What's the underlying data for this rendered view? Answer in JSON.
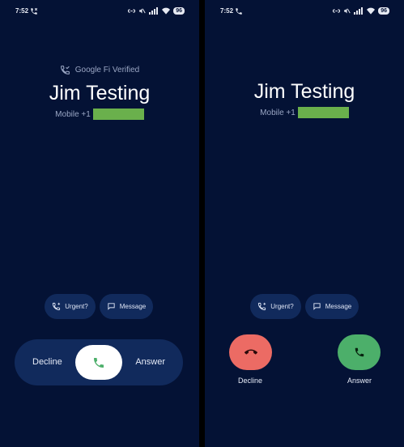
{
  "left_screen": {
    "status": {
      "time": "7:52",
      "battery": "96"
    },
    "verified_label": "Google Fi Verified",
    "caller_name": "Jim Testing",
    "caller_number_prefix": "Mobile +1",
    "chips": {
      "urgent": "Urgent?",
      "message": "Message"
    },
    "swipe": {
      "decline_label": "Decline",
      "answer_label": "Answer"
    }
  },
  "right_screen": {
    "status": {
      "time": "7:52",
      "battery": "96"
    },
    "caller_name": "Jim Testing",
    "caller_number_prefix": "Mobile +1",
    "chips": {
      "urgent": "Urgent?",
      "message": "Message"
    },
    "buttons": {
      "decline_label": "Decline",
      "answer_label": "Answer"
    }
  },
  "icons": {
    "status_call": "phone-icon",
    "link": "link-icon",
    "mute": "mute-icon",
    "signal": "signal-icon",
    "wifi": "wifi-icon",
    "verified": "phone-check-icon",
    "urgent": "phone-urgent-icon",
    "message": "message-bubble-icon",
    "answer": "phone-icon",
    "decline": "phone-hangup-icon"
  },
  "colors": {
    "background": "#041235",
    "chip": "#112a5c",
    "answer_green": "#4caf6a",
    "decline_red": "#ec6b64",
    "redaction": "#6ab04c"
  }
}
